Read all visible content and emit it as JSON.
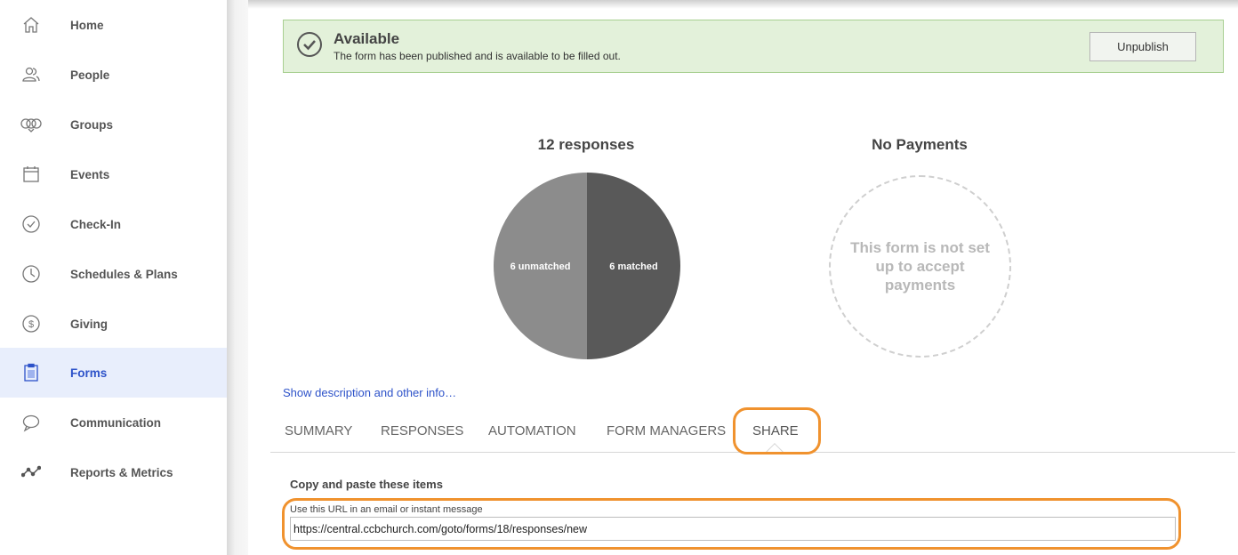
{
  "sidebar": {
    "items": [
      {
        "label": "Home",
        "icon": "home-icon"
      },
      {
        "label": "People",
        "icon": "people-icon"
      },
      {
        "label": "Groups",
        "icon": "groups-icon"
      },
      {
        "label": "Events",
        "icon": "calendar-icon"
      },
      {
        "label": "Check-In",
        "icon": "check-circle-icon"
      },
      {
        "label": "Schedules & Plans",
        "icon": "clock-icon"
      },
      {
        "label": "Giving",
        "icon": "dollar-icon"
      },
      {
        "label": "Forms",
        "icon": "clipboard-icon",
        "active": true
      },
      {
        "label": "Communication",
        "icon": "chat-icon"
      },
      {
        "label": "Reports & Metrics",
        "icon": "line-graph-icon"
      }
    ]
  },
  "status": {
    "title": "Available",
    "description": "The form has been published and is available to be filled out.",
    "button": "Unpublish"
  },
  "responses": {
    "title": "12 responses",
    "slices": [
      {
        "label": "6 unmatched",
        "value": 6,
        "color": "#8c8c8c"
      },
      {
        "label": "6 matched",
        "value": 6,
        "color": "#595959"
      }
    ]
  },
  "payments": {
    "title": "No Payments",
    "message": "This form is not set up to accept payments"
  },
  "description_link": "Show description and other info…",
  "tabs": [
    {
      "label": "SUMMARY"
    },
    {
      "label": "RESPONSES"
    },
    {
      "label": "AUTOMATION"
    },
    {
      "label": "FORM MANAGERS"
    },
    {
      "label": "SHARE",
      "active": true
    }
  ],
  "share": {
    "section_title": "Copy and paste these items",
    "url_label": "Use this URL in an email or instant message",
    "url_value": "https://central.ccbchurch.com/goto/forms/18/responses/new"
  },
  "colors": {
    "accent": "#2d52c9",
    "highlight": "#f0922e",
    "success_bg": "#e3f1da"
  }
}
